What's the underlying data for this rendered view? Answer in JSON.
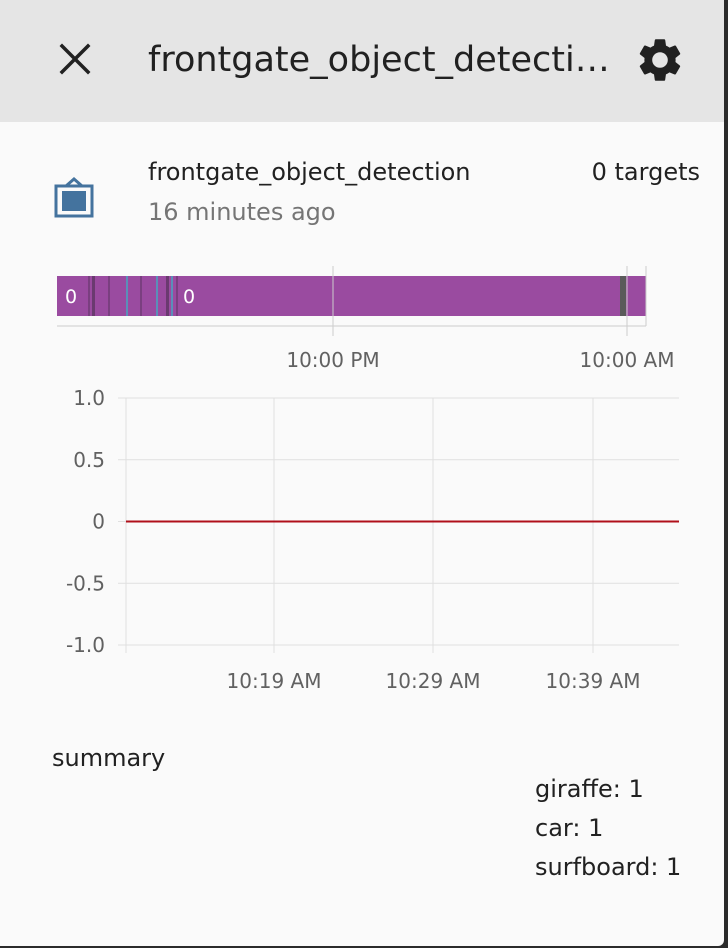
{
  "header": {
    "title": "frontgate_object_detection",
    "close_icon": "close-icon",
    "settings_icon": "gear-icon"
  },
  "entity": {
    "icon": "image-frame-icon",
    "icon_color": "#44739e",
    "name": "frontgate_object_detection",
    "last_changed": "16 minutes ago",
    "state": "0 targets"
  },
  "timeline": {
    "bar_color": "#9a4ba0",
    "labels": [
      "0",
      "0"
    ],
    "ticks": [
      "10:00 PM",
      "10:00 AM"
    ]
  },
  "chart_data": {
    "type": "line",
    "y_ticks": [
      "1.0",
      "0.5",
      "0",
      "-0.5",
      "-1.0"
    ],
    "x_ticks": [
      "10:19 AM",
      "10:29 AM",
      "10:39 AM"
    ],
    "ylim": [
      -1.0,
      1.0
    ],
    "series": [
      {
        "color": "#b0101a",
        "values": [
          0,
          0
        ]
      }
    ],
    "grid": true
  },
  "summary": {
    "label": "summary",
    "items": [
      "giraffe: 1",
      "car: 1",
      "surfboard: 1"
    ]
  }
}
